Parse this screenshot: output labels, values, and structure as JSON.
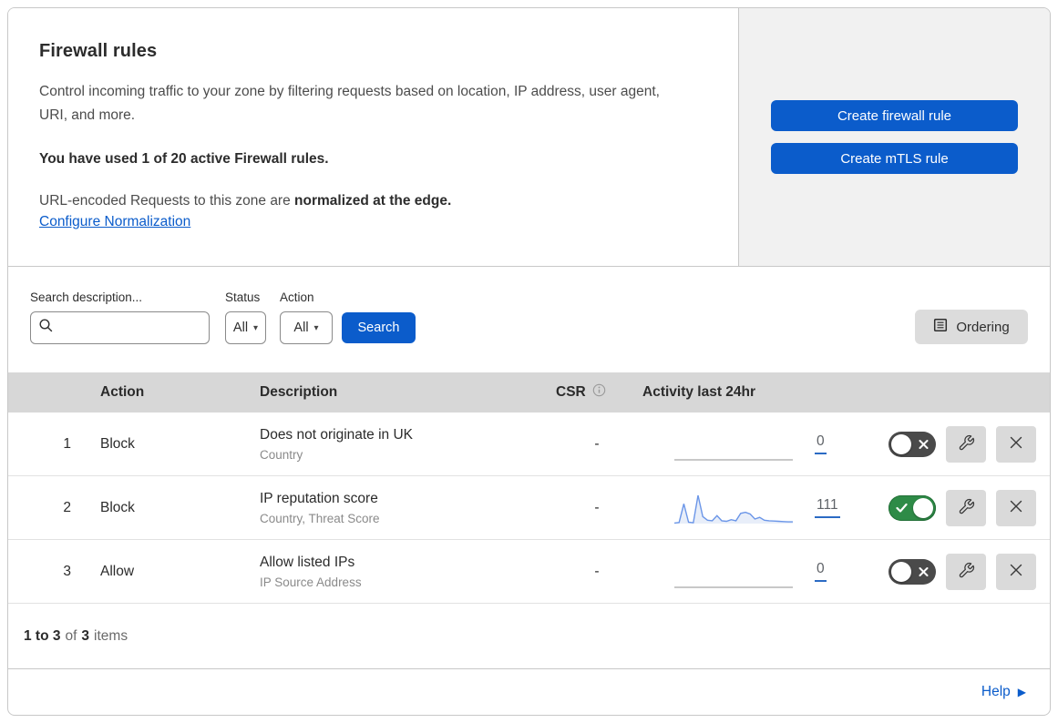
{
  "header": {
    "title": "Firewall rules",
    "description": "Control incoming traffic to your zone by filtering requests based on location, IP address, user agent, URI, and more.",
    "usage_notice": "You have used 1 of 20 active Firewall rules.",
    "normalization_prefix": "URL-encoded Requests to this zone are ",
    "normalization_bold": "normalized at the edge.",
    "normalization_link": "Configure Normalization",
    "create_firewall_button": "Create firewall rule",
    "create_mtls_button": "Create mTLS rule"
  },
  "filters": {
    "search_label": "Search description...",
    "status_label": "Status",
    "status_value": "All",
    "action_label": "Action",
    "action_value": "All",
    "search_button": "Search",
    "ordering_button": "Ordering"
  },
  "table": {
    "headers": {
      "action": "Action",
      "description": "Description",
      "csr": "CSR",
      "activity": "Activity last 24hr"
    },
    "rows": [
      {
        "index": "1",
        "action": "Block",
        "description": "Does not originate in UK",
        "criteria": "Country",
        "csr": "-",
        "activity_count": "0",
        "enabled": false,
        "sparkline": [
          0
        ]
      },
      {
        "index": "2",
        "action": "Block",
        "description": "IP reputation score",
        "criteria": "Country, Threat Score",
        "csr": "-",
        "activity_count": "111",
        "enabled": true,
        "sparkline": [
          2,
          4,
          70,
          5,
          3,
          100,
          25,
          12,
          10,
          28,
          10,
          8,
          14,
          10,
          36,
          40,
          34,
          16,
          22,
          12,
          10,
          9,
          8,
          7,
          6,
          6
        ]
      },
      {
        "index": "3",
        "action": "Allow",
        "description": "Allow listed IPs",
        "criteria": "IP Source Address",
        "csr": "-",
        "activity_count": "0",
        "enabled": false,
        "sparkline": [
          0
        ]
      }
    ]
  },
  "summary": {
    "range": "1 to 3",
    "of_label": "of",
    "total": "3",
    "items_label": "items"
  },
  "help": {
    "label": "Help",
    "arrow": "▶"
  },
  "icons": {
    "search": "search-icon",
    "chevron": "chevron-down-icon",
    "ordering": "list-document-icon",
    "info": "info-icon",
    "wrench": "wrench-icon",
    "close": "close-icon"
  },
  "colors": {
    "primary_blue": "#0b5ccb",
    "link_blue": "#0b5ccb",
    "toggle_on_green": "#2e8b47",
    "toggle_off_gray": "#4a4a4a",
    "sparkline_stroke": "#6b96e8",
    "sparkline_fill": "#e8eef9",
    "flatline_gray": "#a6a6a6",
    "table_header_gray": "#d7d7d7",
    "side_panel_gray": "#f1f1f1"
  }
}
